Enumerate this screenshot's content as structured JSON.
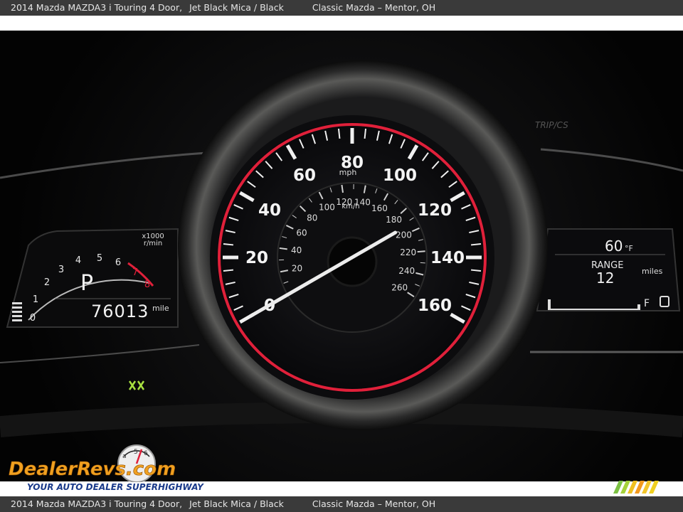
{
  "caption": {
    "title": "2014 Mazda MAZDA3 i Touring 4 Door,",
    "color": "Jet Black Mica / Black",
    "dealer": "Classic Mazda – Mentor, OH"
  },
  "cluster": {
    "speedometer": {
      "mph_ticks": [
        "0",
        "20",
        "40",
        "60",
        "80",
        "100",
        "120",
        "140",
        "160"
      ],
      "mph_unit": "mph",
      "kmh_ticks": [
        "20",
        "40",
        "60",
        "80",
        "100",
        "120",
        "140",
        "160",
        "180",
        "200",
        "220",
        "240",
        "260"
      ],
      "kmh_unit": "km/h",
      "needle_mph": 0
    },
    "tachometer": {
      "ticks": [
        "0",
        "1",
        "2",
        "3",
        "4",
        "5",
        "6",
        "7",
        "8"
      ],
      "unit_top": "x1000",
      "unit_bottom": "r/min",
      "gear": "P"
    },
    "odometer": {
      "value": "76013",
      "unit": "mile"
    },
    "right_display": {
      "temperature": "60",
      "temperature_unit": "°F",
      "range_label": "RANGE",
      "range_value": "12",
      "range_unit": "miles",
      "fuel_full_label": "F"
    },
    "trip_label": "TRIP/CS"
  },
  "watermark": {
    "brand": "DealerRevs.com",
    "tagline": "YOUR AUTO DEALER SUPERHIGHWAY"
  },
  "colors": {
    "accent_red": "#e0203a",
    "needle": "#e8e8e8",
    "caption_bar": "#3a3a3a"
  }
}
